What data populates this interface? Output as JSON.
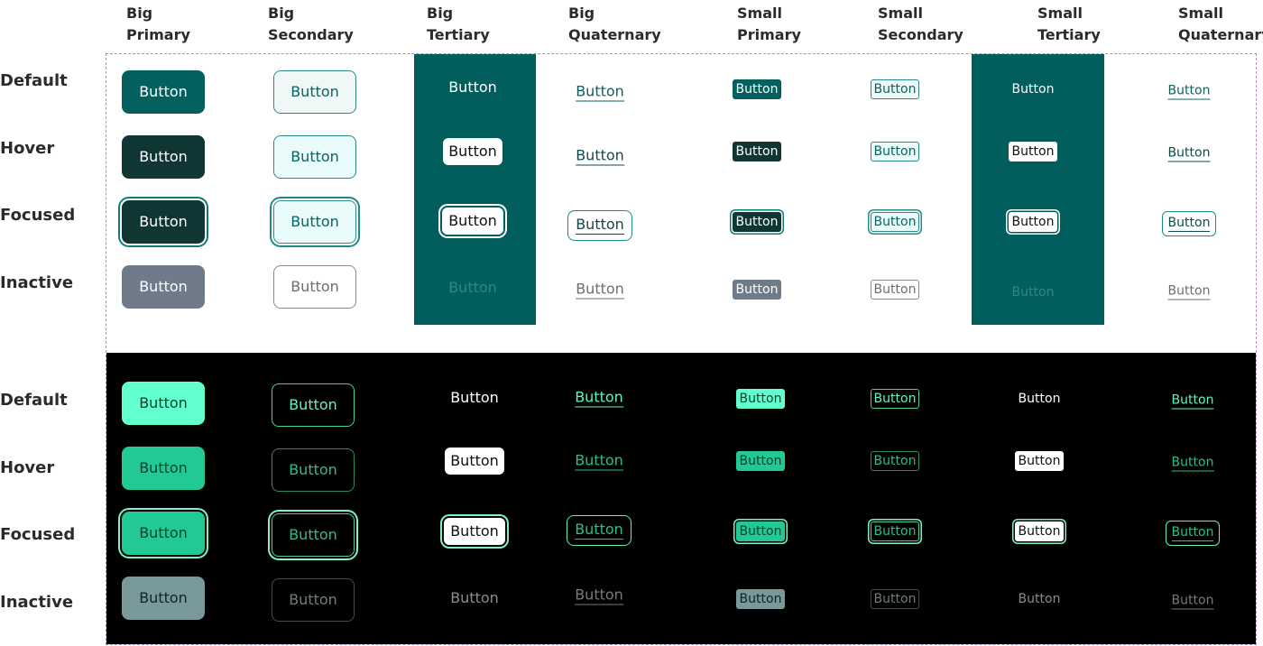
{
  "columns": [
    "Big\nPrimary",
    "Big\nSecondary",
    "Big\nTertiary",
    "Big\nQuaternary",
    "Small\nPrimary",
    "Small\nSecondary",
    "Small\nTertiary",
    "Small\nQuaternary"
  ],
  "rows": [
    "Default",
    "Hover",
    "Focused",
    "Inactive"
  ],
  "dark_rows": [
    "Default",
    "Hover",
    "Focused",
    "Inactive"
  ],
  "button_label": "Button",
  "colors": {
    "light_primary": "#04605e",
    "light_hover": "#0f3534",
    "light_inactive": "#6f7b89",
    "tertiary_panel": "#025e5c",
    "dark_primary": "#62ffcf",
    "dark_hover": "#23c994",
    "dark_inactive": "#78989a",
    "focus_frame_border": "#b48ad4"
  }
}
